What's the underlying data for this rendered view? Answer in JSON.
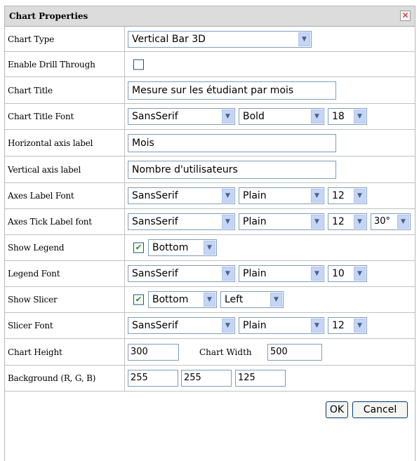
{
  "dialog": {
    "title": "Chart Properties",
    "close_glyph": "✕"
  },
  "rows": {
    "chart_type": {
      "label": "Chart Type",
      "value": "Vertical Bar 3D"
    },
    "drill_through": {
      "label": "Enable Drill Through",
      "checked": false
    },
    "chart_title": {
      "label": "Chart Title",
      "value": "Mesure sur les étudiant par mois"
    },
    "chart_title_font": {
      "label": "Chart Title Font",
      "family": "SansSerif",
      "style": "Bold",
      "size": "18"
    },
    "h_axis_label": {
      "label": "Horizontal axis label",
      "value": "Mois"
    },
    "v_axis_label": {
      "label": "Vertical axis label",
      "value": "Nombre d'utilisateurs"
    },
    "axes_label_font": {
      "label": "Axes Label Font",
      "family": "SansSerif",
      "style": "Plain",
      "size": "12"
    },
    "axes_tick_font": {
      "label": "Axes Tick Label font",
      "family": "SansSerif",
      "style": "Plain",
      "size": "12",
      "angle": "30°"
    },
    "show_legend": {
      "label": "Show Legend",
      "checked": true,
      "position": "Bottom"
    },
    "legend_font": {
      "label": "Legend Font",
      "family": "SansSerif",
      "style": "Plain",
      "size": "10"
    },
    "show_slicer": {
      "label": "Show Slicer",
      "checked": true,
      "position": "Bottom",
      "align": "Left"
    },
    "slicer_font": {
      "label": "Slicer Font",
      "family": "SansSerif",
      "style": "Plain",
      "size": "12"
    },
    "chart_size": {
      "label": "Chart Height",
      "height": "300",
      "width_label": "Chart Width",
      "width": "500"
    },
    "background": {
      "label": "Background (R, G, B)",
      "r": "255",
      "g": "255",
      "b": "125"
    }
  },
  "buttons": {
    "ok": "OK",
    "cancel": "Cancel"
  },
  "icons": {
    "dropdown_arrow": "▼",
    "checkmark": "✔"
  }
}
